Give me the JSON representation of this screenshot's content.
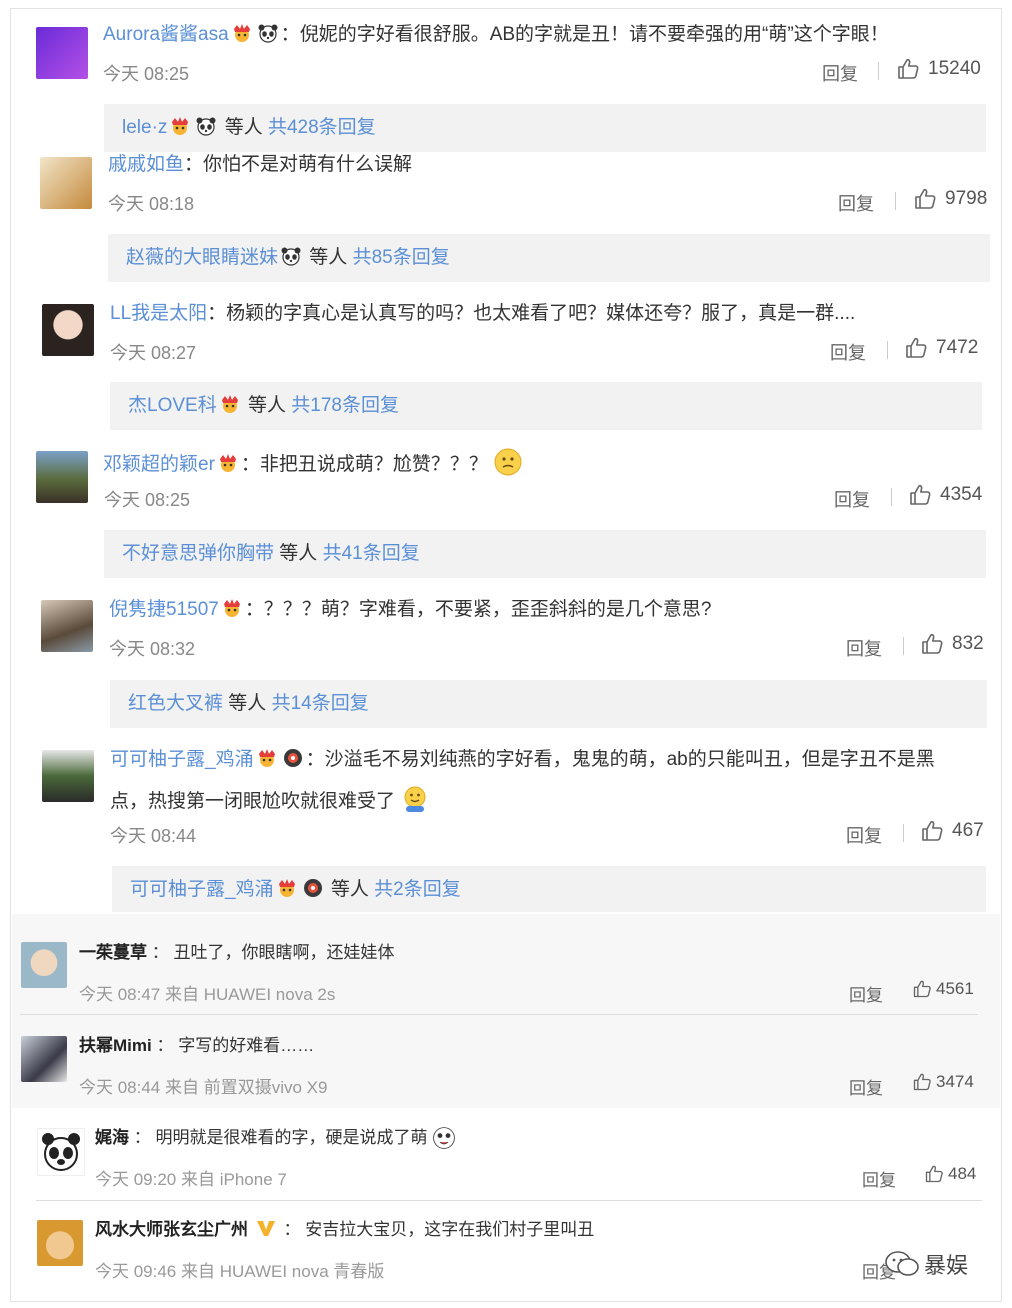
{
  "ui": {
    "reply_label": "回复",
    "others": "等人",
    "colon": "："
  },
  "c1": {
    "name": "Aurora酱酱asa",
    "text": "倪妮的字好看很舒服。AB的字就是丑！请不要牵强的用“萌”这个字眼！",
    "time": "今天 08:25",
    "likes": "15240",
    "sub": {
      "name": "lele·z",
      "count": "共428条回复"
    }
  },
  "c2": {
    "name": "戚戚如鱼",
    "text": "你怕不是对萌有什么误解",
    "time": "今天 08:18",
    "likes": "9798",
    "sub": {
      "name": "赵薇的大眼睛迷妹",
      "count": "共85条回复"
    }
  },
  "c3": {
    "name": "LL我是太阳",
    "text": "杨颖的字真心是认真写的吗？也太难看了吧？媒体还夸？服了，真是一群....",
    "time": "今天 08:27",
    "likes": "7472",
    "sub": {
      "name": "杰LOVE科",
      "count": "共178条回复"
    }
  },
  "c4": {
    "name": "邓颖超的颖er",
    "text": "非把丑说成萌？尬赞？？？",
    "time": "今天 08:25",
    "likes": "4354",
    "sub": {
      "name": "不好意思弹你胸带",
      "count": "共41条回复"
    }
  },
  "c5": {
    "name": "倪隽捷51507",
    "text": "？？？萌？字难看，不要紧，歪歪斜斜的是几个意思?",
    "time": "今天 08:32",
    "likes": "832",
    "sub": {
      "name": "红色大叉裤",
      "count": "共14条回复"
    }
  },
  "c6": {
    "name": "可可柚子露_鸡涌",
    "text1": "沙溢毛不易刘纯燕的字好看，鬼鬼的萌，ab的只能叫丑，但是字丑不是黑",
    "text2": "点，热搜第一闭眼尬吹就很难受了",
    "time": "今天 08:44",
    "likes": "467",
    "sub": {
      "name": "可可柚子露_鸡涌",
      "count": "共2条回复"
    }
  },
  "l1": {
    "name": "一茱蔓草",
    "text": "丑吐了，你眼瞎啊，还娃娃体",
    "time": "今天 08:47 来自 HUAWEI nova 2s",
    "likes": "4561"
  },
  "l2": {
    "name": "扶幂Mimi",
    "text": "字写的好难看……",
    "time": "今天 08:44 来自 前置双摄vivo X9",
    "likes": "3474"
  },
  "l3": {
    "name": "娓海",
    "text": "明明就是很难看的字，硬是说成了萌",
    "time": "今天 09:20 来自 iPhone 7",
    "likes": "484"
  },
  "l4": {
    "name": "风水大师张玄尘广州",
    "text": "安吉拉大宝贝，这字在我们村子里叫丑",
    "time": "今天 09:46 来自 HUAWEI nova 青春版",
    "reply": "回复"
  },
  "watermark": "暴娱",
  "colors": {
    "link": "#5b8fd6",
    "gray_box": "#f2f2f2"
  }
}
